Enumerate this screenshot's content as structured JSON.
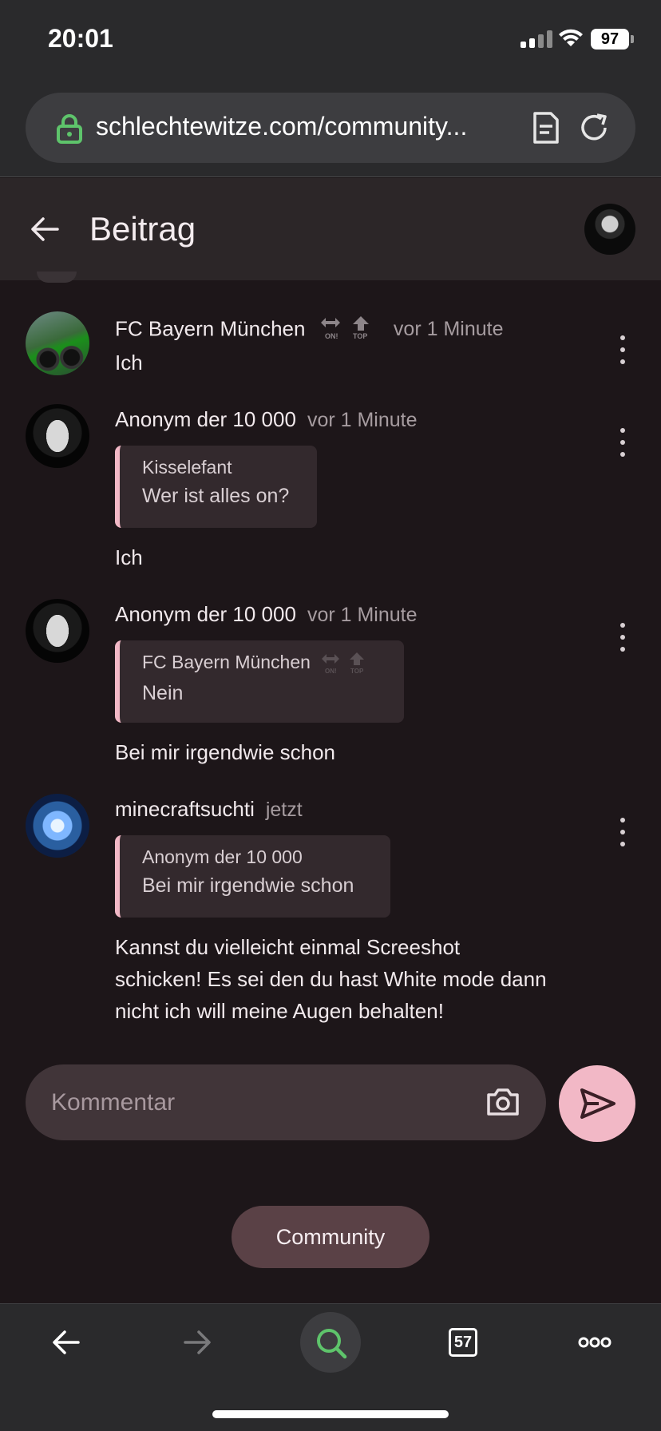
{
  "status": {
    "time": "20:01",
    "battery": "97"
  },
  "browser": {
    "url": "schlechtewitze.com/community...",
    "tab_count": "57"
  },
  "header": {
    "title": "Beitrag"
  },
  "comments": [
    {
      "author": "FC Bayern München",
      "time": "vor 1 Minute",
      "badges": true,
      "text": "Ich"
    },
    {
      "author": "Anonym der 10 000",
      "time": "vor 1 Minute",
      "quote": {
        "author": "Kisselefant",
        "text": "Wer ist alles on?"
      },
      "text": "Ich"
    },
    {
      "author": "Anonym der 10 000",
      "time": "vor 1 Minute",
      "quote": {
        "author": "FC Bayern München",
        "text": "Nein"
      },
      "text": "Bei mir irgendwie schon"
    },
    {
      "author": "minecraftsuchti",
      "time": "jetzt",
      "quote": {
        "author": "Anonym der 10 000",
        "text": "Bei mir irgendwie schon"
      },
      "text_lines": [
        "Kannst du vielleicht einmal Screeshot",
        "schicken! Es sei den du hast White mode dann",
        "nicht ich will meine Augen behalten!"
      ]
    }
  ],
  "composer": {
    "placeholder": "Kommentar"
  },
  "community_button": "Community",
  "badge_labels": {
    "on": "ON!",
    "top": "TOP"
  },
  "colors": {
    "accent": "#f2b8c6",
    "background": "#1d1619",
    "lock": "#5ec46b",
    "search": "#5ec46b"
  }
}
